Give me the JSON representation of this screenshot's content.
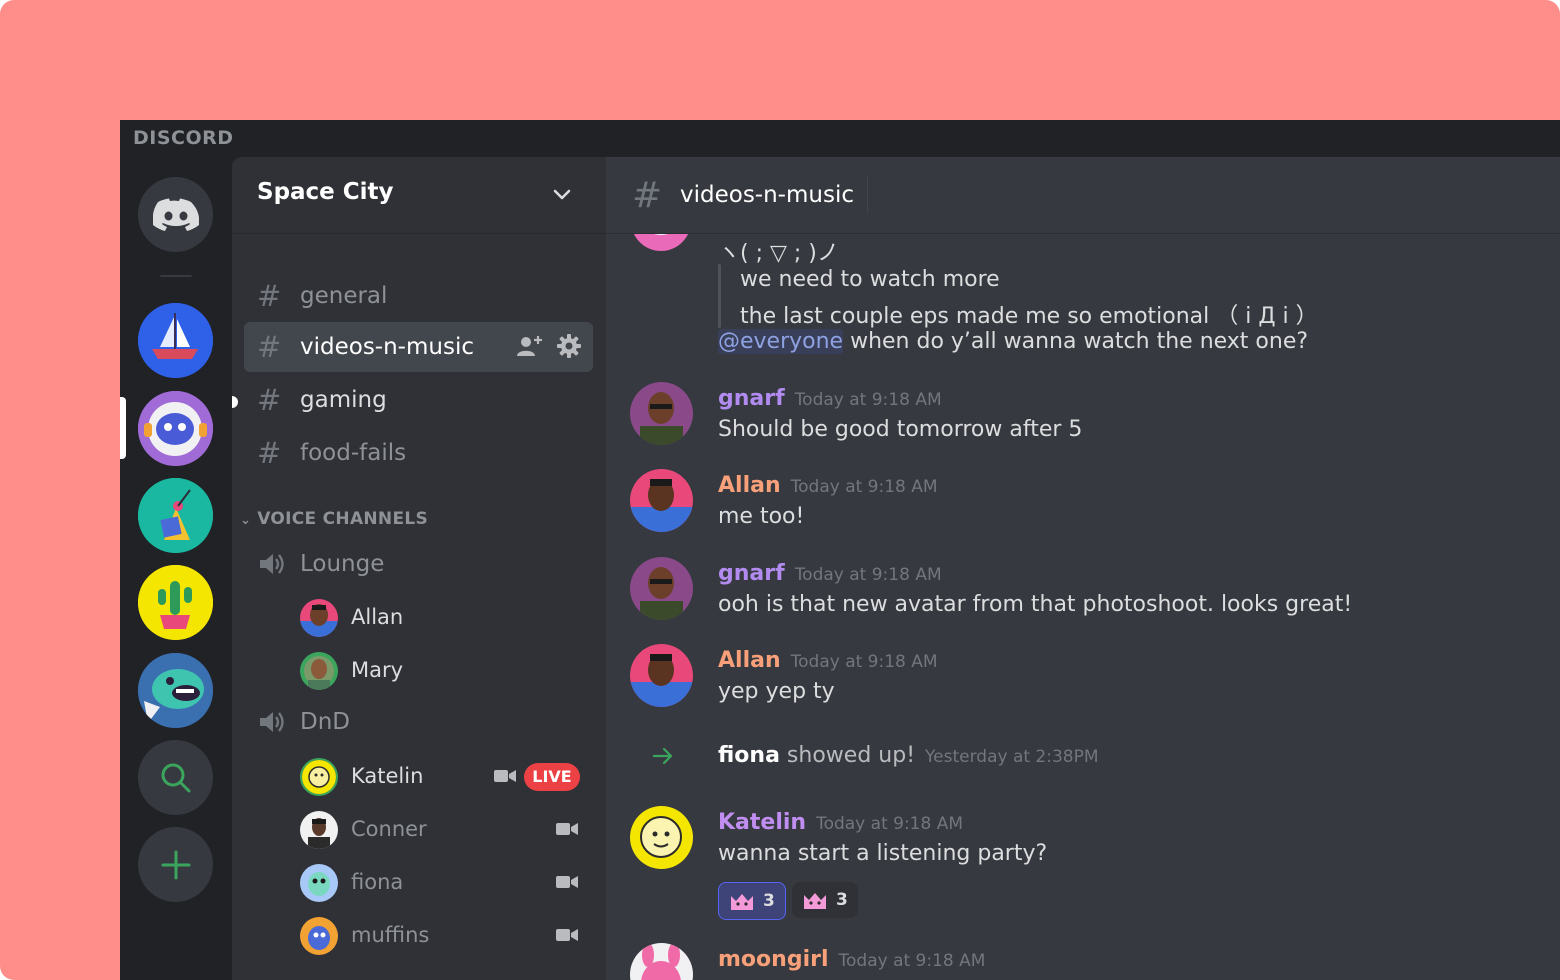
{
  "app": {
    "brand": "DISCORD"
  },
  "colors": {
    "backdrop": "#ff8e8b",
    "accent": "#5865f2",
    "gnarf": "#b28bf0",
    "allan": "#f8a07a",
    "katelin": "#c08ef0",
    "moongirl": "#f8a07a",
    "live": "#ed4245"
  },
  "rail": {
    "items": [
      {
        "name": "home",
        "icon": "discord-logo-icon"
      },
      {
        "name": "sailboat-server",
        "icon": "sailboat-icon"
      },
      {
        "name": "astronaut-server",
        "icon": "astronaut-icon"
      },
      {
        "name": "triangle-server",
        "icon": "triangle-art-icon"
      },
      {
        "name": "cactus-server",
        "icon": "cactus-icon"
      },
      {
        "name": "monster-server",
        "icon": "monster-icon"
      },
      {
        "name": "explore",
        "icon": "search-icon"
      },
      {
        "name": "add-server",
        "icon": "plus-icon"
      }
    ]
  },
  "sidebar": {
    "server_name": "Space City",
    "text_channels": [
      {
        "label": "general",
        "active": false
      },
      {
        "label": "videos-n-music",
        "active": true
      },
      {
        "label": "gaming",
        "active": false
      },
      {
        "label": "food-fails",
        "active": false
      }
    ],
    "voice_category": "VOICE CHANNELS",
    "voice_channels": [
      {
        "label": "Lounge",
        "users": [
          {
            "name": "Allan"
          },
          {
            "name": "Mary"
          }
        ]
      },
      {
        "label": "DnD",
        "users": [
          {
            "name": "Katelin",
            "live": "LIVE"
          },
          {
            "name": "Conner"
          },
          {
            "name": "fiona"
          },
          {
            "name": "muffins"
          }
        ]
      }
    ]
  },
  "chat": {
    "channel": "videos-n-music",
    "partial": {
      "line1": "ヽ( ; ▽ ; )ノ",
      "quote1": "we need to watch more",
      "quote2": "the last couple eps made me so emotional （ i Д i ）",
      "mention": "@everyone",
      "after_mention": " when do y’all wanna watch the next one?"
    },
    "messages": [
      {
        "author": "gnarf",
        "time": "Today at 9:18 AM",
        "text": "Should be good tomorrow after 5"
      },
      {
        "author": "Allan",
        "time": "Today at 9:18 AM",
        "text": "me too!"
      },
      {
        "author": "gnarf",
        "time": "Today at 9:18 AM",
        "text": "ooh is that new avatar from that photoshoot. looks great!"
      },
      {
        "author": "Allan",
        "time": "Today at 9:18 AM",
        "text": "yep yep ty"
      }
    ],
    "system": {
      "user": "fiona",
      "text": " showed up!",
      "time": "Yesterday at 2:38PM"
    },
    "katelin": {
      "author": "Katelin",
      "time": "Today at 9:18 AM",
      "text": "wanna start a listening party?",
      "reactions": [
        {
          "count": "3"
        },
        {
          "count": "3"
        }
      ]
    },
    "moongirl": {
      "author": "moongirl",
      "time": "Today at 9:18 AM"
    }
  }
}
